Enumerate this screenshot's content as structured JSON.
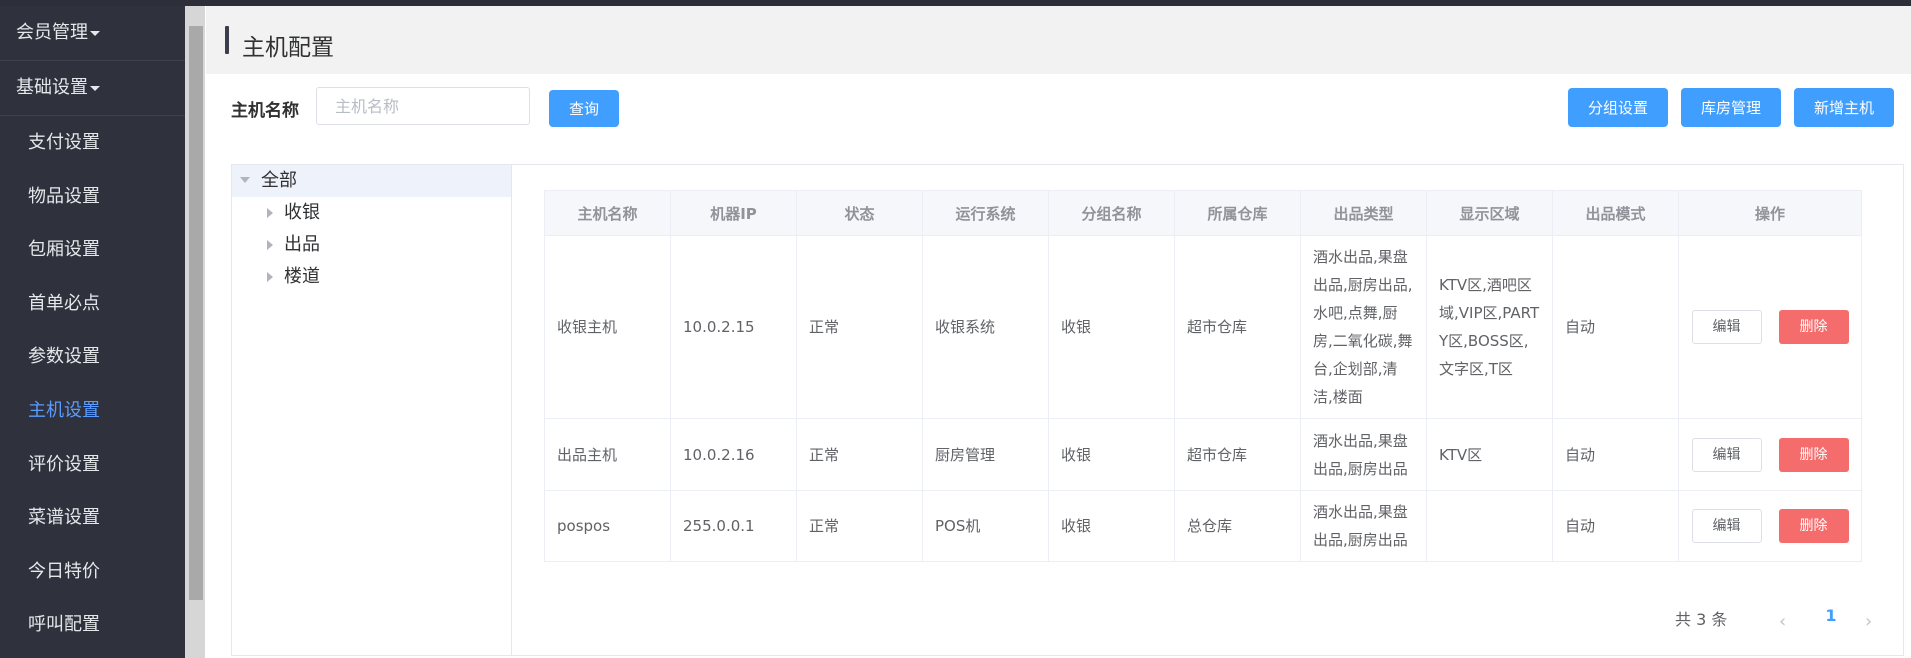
{
  "sidebar": {
    "groups": [
      {
        "label": "会员管理"
      },
      {
        "label": "基础设置"
      }
    ],
    "items": [
      {
        "label": "支付设置"
      },
      {
        "label": "物品设置"
      },
      {
        "label": "包厢设置"
      },
      {
        "label": "首单必点"
      },
      {
        "label": "参数设置"
      },
      {
        "label": "主机设置",
        "active": true
      },
      {
        "label": "评价设置"
      },
      {
        "label": "菜谱设置"
      },
      {
        "label": "今日特价"
      },
      {
        "label": "呼叫配置"
      }
    ]
  },
  "page": {
    "title": "主机配置"
  },
  "search": {
    "label": "主机名称",
    "placeholder": "主机名称",
    "value": "",
    "button": "查询"
  },
  "toolbar": {
    "group_settings": "分组设置",
    "warehouse": "库房管理",
    "add_host": "新增主机"
  },
  "tree": {
    "root": "全部",
    "children": [
      "收银",
      "出品",
      "楼道"
    ]
  },
  "table": {
    "headers": [
      "主机名称",
      "机器IP",
      "状态",
      "运行系统",
      "分组名称",
      "所属仓库",
      "出品类型",
      "显示区域",
      "出品模式",
      "操作"
    ],
    "rows": [
      {
        "name": "收银主机",
        "ip": "10.0.2.15",
        "status": "正常",
        "system": "收银系统",
        "group": "收银",
        "warehouse": "超市仓库",
        "types": "酒水出品,果盘出品,厨房出品,水吧,点舞,厨房,二氧化碳,舞台,企划部,清洁,楼面",
        "area": "KTV区,酒吧区域,VIP区,PARTY区,BOSS区,文字区,T区",
        "mode": "自动",
        "edit": "编辑",
        "delete": "删除"
      },
      {
        "name": "出品主机",
        "ip": "10.0.2.16",
        "status": "正常",
        "system": "厨房管理",
        "group": "收银",
        "warehouse": "超市仓库",
        "types": "酒水出品,果盘出品,厨房出品",
        "area": "KTV区",
        "mode": "自动",
        "edit": "编辑",
        "delete": "删除"
      },
      {
        "name": "pospos",
        "ip": "255.0.0.1",
        "status": "正常",
        "system": "POS机",
        "group": "收银",
        "warehouse": "总仓库",
        "types": "酒水出品,果盘出品,厨房出品",
        "area": "",
        "mode": "自动",
        "edit": "编辑",
        "delete": "删除"
      }
    ]
  },
  "pagination": {
    "total_text": "共 3 条",
    "current_page": "1",
    "prev_icon": "‹",
    "next_icon": "›"
  },
  "colors": {
    "primary": "#409eff",
    "danger": "#f56c6c",
    "sidebar_bg": "#2f323c",
    "active_menu": "#5b9bff"
  }
}
